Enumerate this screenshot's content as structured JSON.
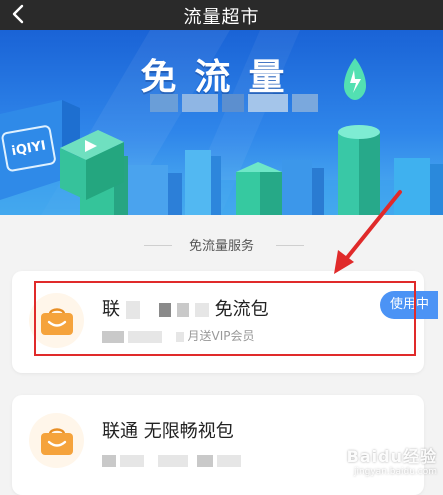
{
  "header": {
    "title": "流量超市",
    "back_icon": "chevron-left-icon"
  },
  "banner": {
    "title": "免流量",
    "logo_text": "iQIYI"
  },
  "section": {
    "title": "免流量服务"
  },
  "packages": [
    {
      "name_prefix": "联",
      "name_suffix": "免流包",
      "desc_suffix": "月送VIP会员",
      "status": "使用中",
      "icon": "shopping-bag-icon"
    },
    {
      "name": "联通 无限畅视包",
      "icon": "shopping-bag-icon"
    }
  ],
  "watermark": {
    "main": "Baidu经验",
    "sub": "jingyan.baidu.com"
  },
  "colors": {
    "topbar": "#2a2a2a",
    "banner": "#2f86ea",
    "badge": "#4b93f5",
    "highlight": "#e02a2a",
    "icon": "#f5a33c"
  }
}
